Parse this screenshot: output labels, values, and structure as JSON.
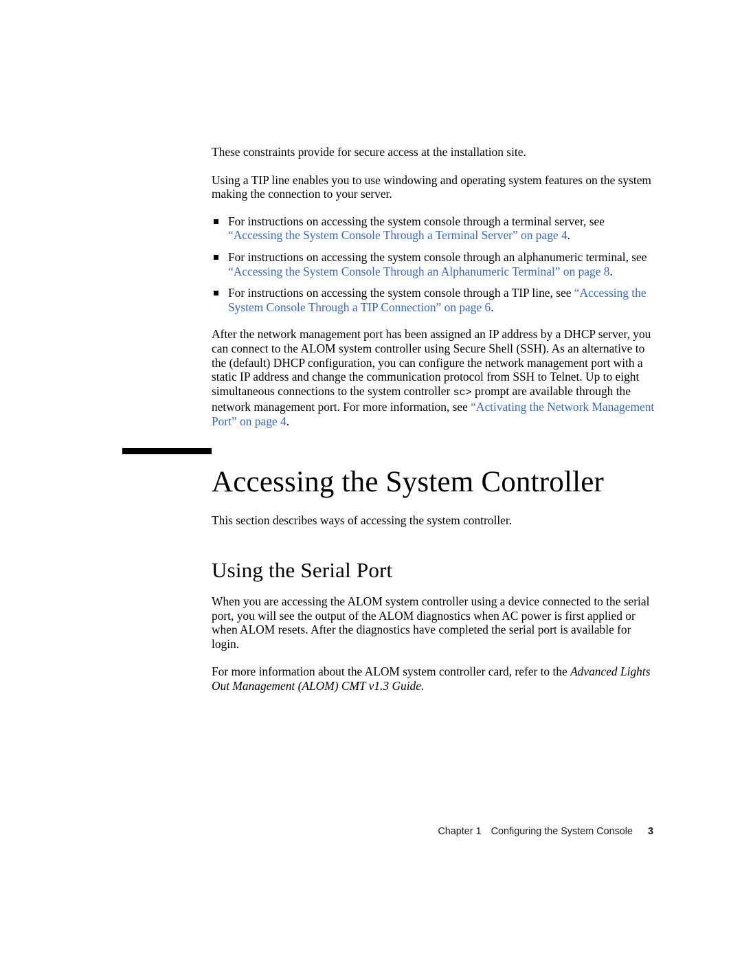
{
  "document": {
    "intro_paragraph": "These constraints provide for secure access at the installation site.",
    "tip_paragraph": "Using a TIP line enables you to use windowing and operating system features on the system making the connection to your server."
  },
  "bullets": [
    {
      "lead_text": "For instructions on accessing the system console through a terminal server, see ",
      "link_text": "“Accessing the System Console Through a Terminal Server” on page 4",
      "trailing_text": "."
    },
    {
      "lead_text": "For instructions on accessing the system console through an alphanumeric terminal, see ",
      "link_text": "“Accessing the System Console Through an Alphanumeric Terminal” on page 8",
      "trailing_text": "."
    },
    {
      "lead_text": "For instructions on accessing the system console through a TIP line, see ",
      "link_text": "“Accessing the System Console Through a TIP  Connection” on page 6",
      "trailing_text": "."
    }
  ],
  "dhcp_paragraph": {
    "part1": "After the network management port has been assigned an IP address by a DHCP server, you can connect to the ALOM system controller using Secure Shell (SSH). As an alternative to the (default) DHCP configuration, you can configure the network management port with a static IP address and change the communication protocol from SSH to Telnet. Up to eight simultaneous connections to the system controller ",
    "mono": "sc>",
    "part2": " prompt are available through the network management port. For more information, see ",
    "link_text": "“Activating the Network Management Port” on page 4",
    "part3": "."
  },
  "chapter_heading": "Accessing the System Controller",
  "section_intro": "This section describes ways of accessing the system controller.",
  "sub_heading": "Using the Serial Port",
  "serial_paragraph": "When you are accessing the ALOM system controller using a device connected to the serial port, you will see the output of the ALOM diagnostics when AC power is first applied or when ALOM resets. After the diagnostics have completed the serial port is available for login.",
  "reference_paragraph": {
    "lead_text": "For more information about the ALOM system controller card, refer to the ",
    "book_title": "Advanced Lights Out Management (ALOM) CMT v1.3 Guide."
  },
  "footer": {
    "chapter": "Chapter 1",
    "title": "Configuring the System Console",
    "page": "3"
  },
  "colors": {
    "link": "#3366cc",
    "text": "#000000",
    "page_background": "#ffffff"
  }
}
